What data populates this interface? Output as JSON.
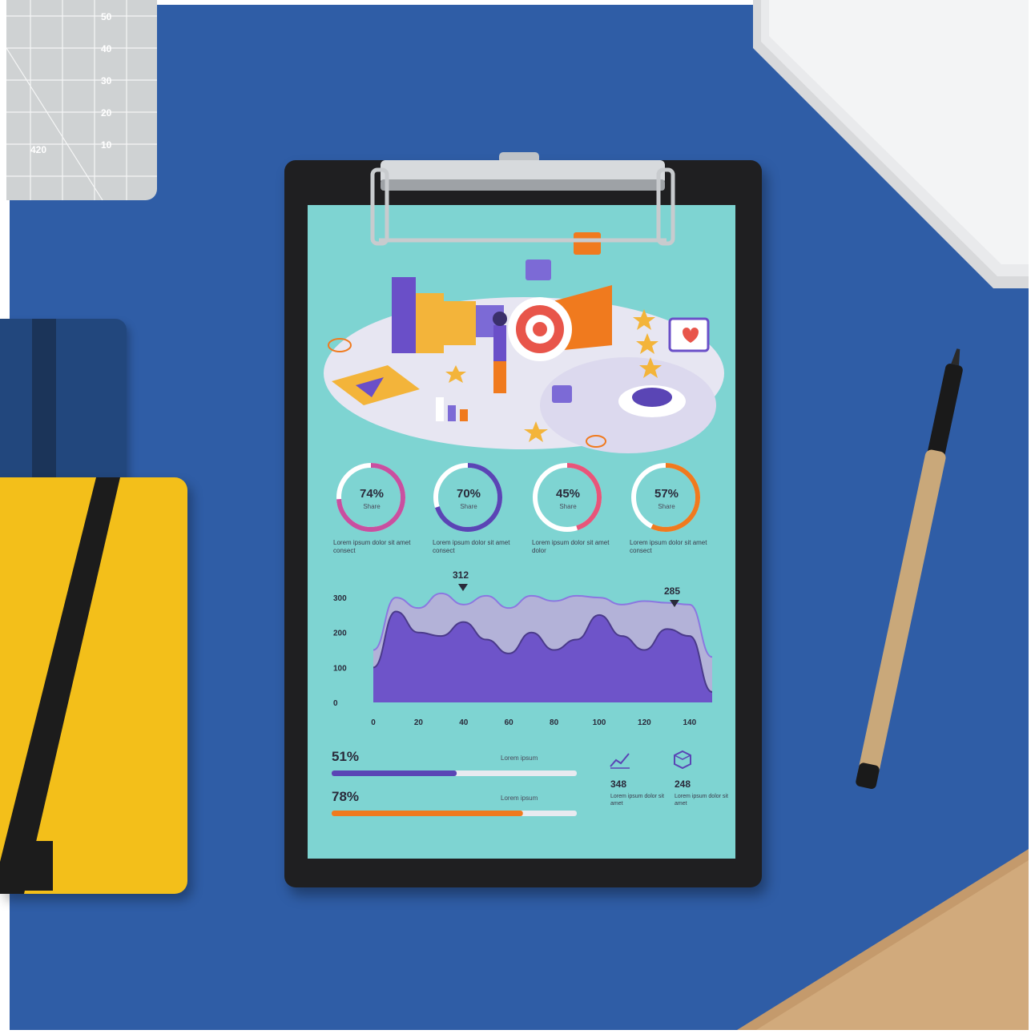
{
  "cutting_mat": {
    "numbers": [
      "50",
      "40",
      "30",
      "20",
      "10",
      "420"
    ]
  },
  "infographic": {
    "donuts": [
      {
        "value": "74%",
        "fraction": 0.74,
        "sublabel": "Share",
        "caption": "Lorem ipsum dolor sit amet consect",
        "color": "#c94fa0"
      },
      {
        "value": "70%",
        "fraction": 0.7,
        "sublabel": "Share",
        "caption": "Lorem ipsum dolor sit amet consect",
        "color": "#5a45b5"
      },
      {
        "value": "45%",
        "fraction": 0.45,
        "sublabel": "Share",
        "caption": "Lorem ipsum dolor sit amet dolor",
        "color": "#e8557a"
      },
      {
        "value": "57%",
        "fraction": 0.57,
        "sublabel": "Share",
        "caption": "Lorem ipsum dolor sit amet consect",
        "color": "#f07a1e"
      }
    ],
    "peaks": {
      "left": "312",
      "right": "285"
    },
    "progress": [
      {
        "value": "51%",
        "fraction": 0.51,
        "label": "Lorem ipsum",
        "color": "#5a45b5"
      },
      {
        "value": "78%",
        "fraction": 0.78,
        "label": "Lorem ipsum",
        "color": "#f07a1e"
      }
    ],
    "stats": [
      {
        "icon": "line-chart-icon",
        "value": "348",
        "text": "Lorem ipsum dolor sit amet"
      },
      {
        "icon": "cube-icon",
        "value": "248",
        "text": "Lorem ipsum dolor sit amet"
      }
    ]
  },
  "chart_data": {
    "type": "area",
    "x": [
      0,
      10,
      20,
      30,
      40,
      50,
      60,
      70,
      80,
      90,
      100,
      110,
      120,
      130,
      140,
      150
    ],
    "xticks": [
      "0",
      "20",
      "40",
      "60",
      "80",
      "100",
      "120",
      "140"
    ],
    "yticks": [
      "0",
      "100",
      "200",
      "300"
    ],
    "ylim": [
      0,
      330
    ],
    "xlim": [
      0,
      150
    ],
    "series": [
      {
        "values": [
          150,
          300,
          270,
          312,
          280,
          305,
          270,
          305,
          290,
          305,
          300,
          280,
          290,
          285,
          280,
          130
        ],
        "color": "#b9aed8"
      },
      {
        "values": [
          100,
          260,
          200,
          190,
          230,
          180,
          140,
          200,
          150,
          180,
          250,
          190,
          150,
          210,
          190,
          30
        ],
        "color": "#6a4fc8"
      }
    ],
    "title": "",
    "xlabel": "",
    "ylabel": ""
  }
}
